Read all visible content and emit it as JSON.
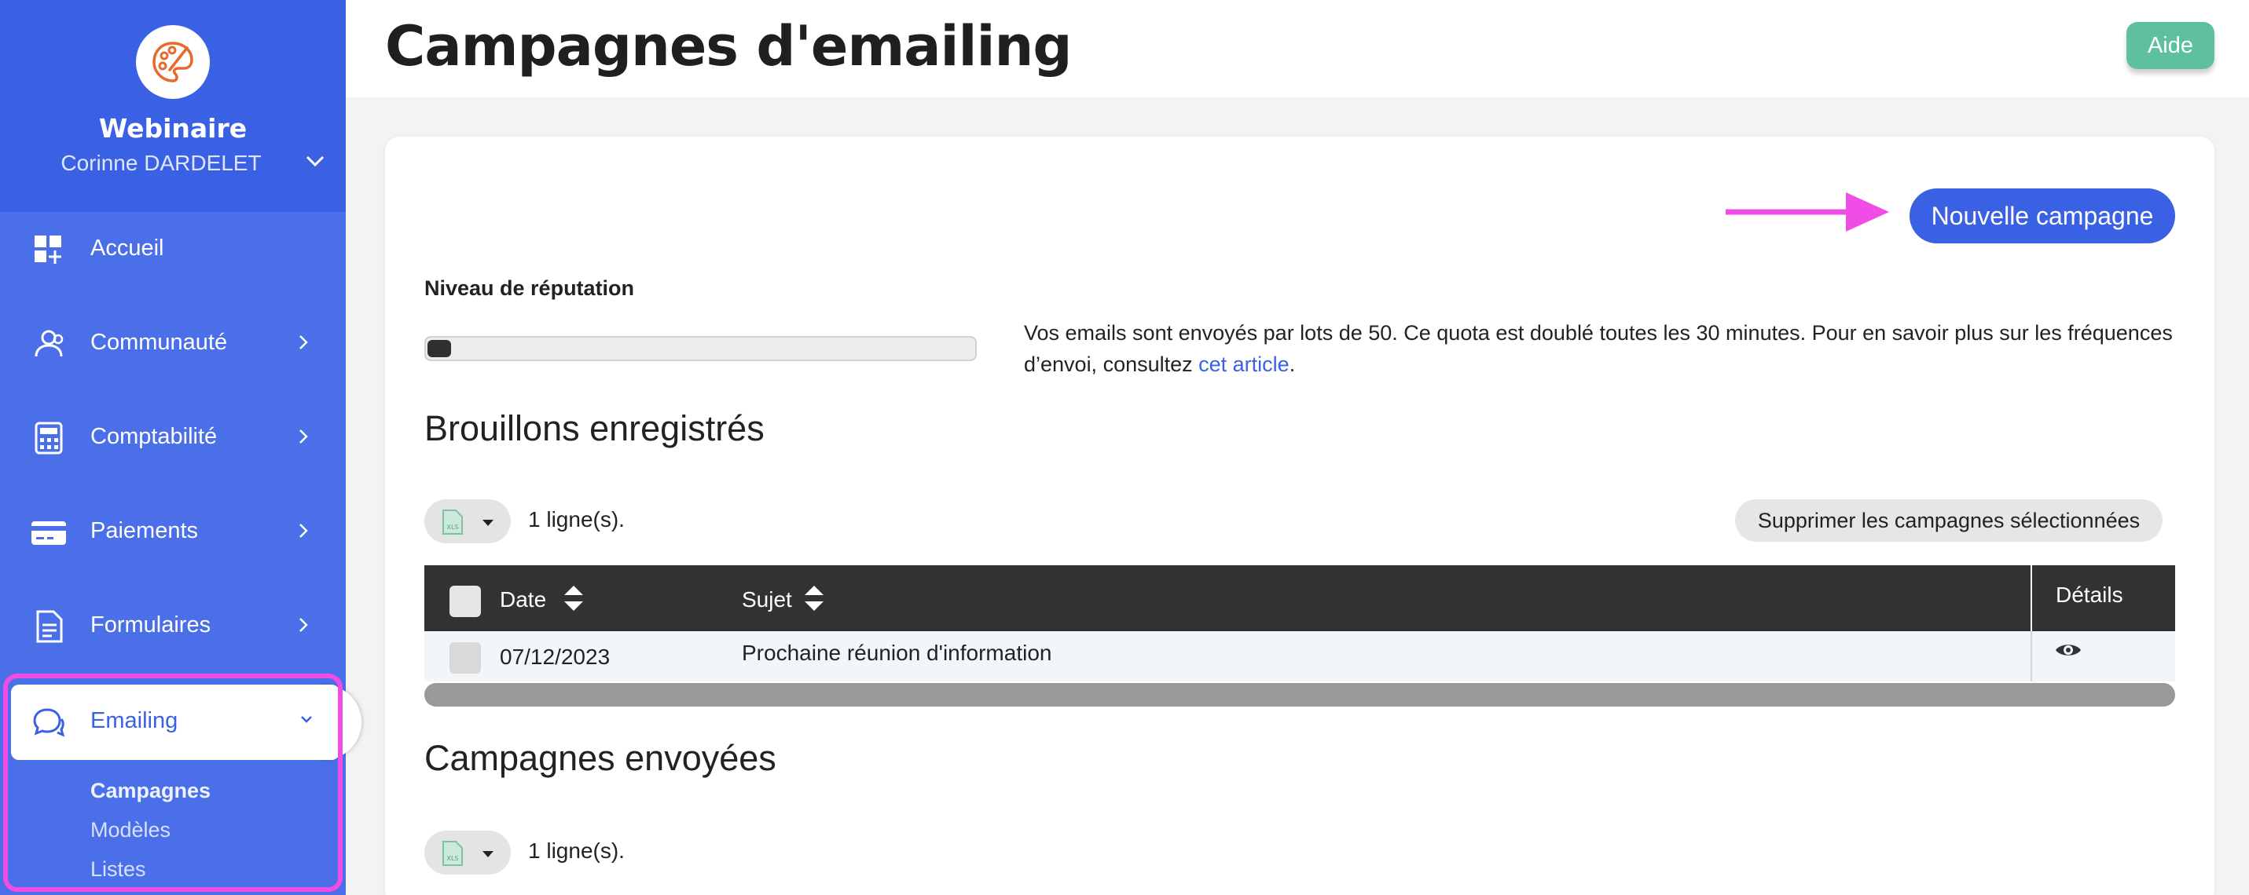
{
  "sidebar": {
    "org_name": "Webinaire",
    "user_name": "Corinne DARDELET",
    "items": [
      {
        "label": "Accueil",
        "icon": "dashboard-icon"
      },
      {
        "label": "Communauté",
        "icon": "users-icon"
      },
      {
        "label": "Comptabilité",
        "icon": "calculator-icon"
      },
      {
        "label": "Paiements",
        "icon": "credit-card-icon"
      },
      {
        "label": "Formulaires",
        "icon": "document-icon"
      },
      {
        "label": "Emailing",
        "icon": "chat-icon"
      }
    ],
    "sub_items": [
      "Campagnes",
      "Modèles",
      "Listes"
    ]
  },
  "header": {
    "title": "Campagnes d'emailing",
    "help_label": "Aide"
  },
  "main": {
    "new_campaign_label": "Nouvelle campagne",
    "reputation_label": "Niveau de réputation",
    "reputation_level": 0.04,
    "info_text": "Vos emails sont envoyés par lots de 50. Ce quota est doublé toutes les 30 minutes. Pour en savoir plus sur les fréquences d’envoi, consultez ",
    "info_link": "cet article",
    "info_end": ".",
    "drafts": {
      "title": "Brouillons enregistrés",
      "row_count": "1 ligne(s).",
      "delete_label": "Supprimer les campagnes sélectionnées",
      "columns": [
        "Date",
        "Sujet",
        "Détails"
      ],
      "rows": [
        {
          "date": "07/12/2023",
          "subject": "Prochaine réunion d'information"
        }
      ]
    },
    "sent": {
      "title": "Campagnes envoyées",
      "row_count": "1 ligne(s)."
    }
  },
  "colors": {
    "sidebar": "#4a6fe8",
    "sidebar_header": "#3a61e4",
    "accent": "#3a61e4",
    "help": "#5ec0a0",
    "highlight": "#f04ce6"
  }
}
